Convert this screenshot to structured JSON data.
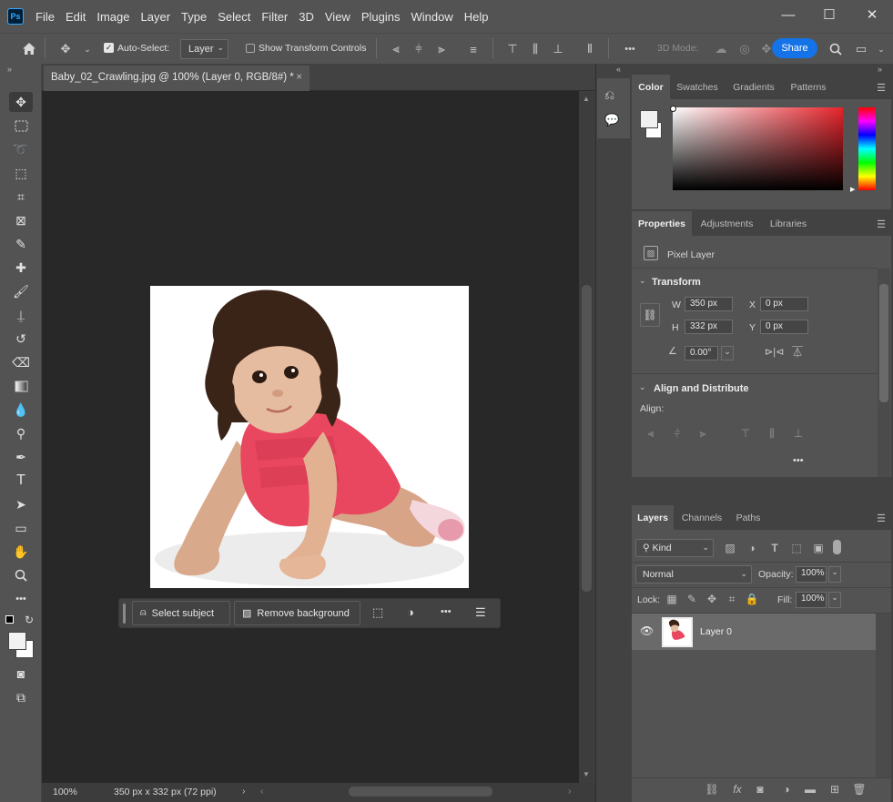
{
  "app": {
    "logo_text": "Ps"
  },
  "menu": [
    "File",
    "Edit",
    "Image",
    "Layer",
    "Type",
    "Select",
    "Filter",
    "3D",
    "View",
    "Plugins",
    "Window",
    "Help"
  ],
  "window_controls": {
    "minimize": "—",
    "maximize": "☐",
    "close": "✕"
  },
  "options": {
    "auto_select_label": "Auto-Select:",
    "auto_select_checked": true,
    "auto_select_target": "Layer",
    "show_transform_label": "Show Transform Controls",
    "mode_label": "3D Mode:",
    "share_label": "Share",
    "more": "•••"
  },
  "document": {
    "tab_title": "Baby_02_Crawling.jpg @ 100% (Layer 0, RGB/8#) *",
    "zoom": "100%",
    "info": "350 px x 332 px (72 ppi)"
  },
  "context_bar": {
    "select_subject": "Select subject",
    "remove_background": "Remove background",
    "more": "•••"
  },
  "color_panel": {
    "tabs": [
      "Color",
      "Swatches",
      "Gradients",
      "Patterns"
    ],
    "active_tab": "Color",
    "hue_color": "#e8242c"
  },
  "properties_panel": {
    "tabs": [
      "Properties",
      "Adjustments",
      "Libraries"
    ],
    "layer_type": "Pixel Layer",
    "transform_title": "Transform",
    "w_label": "W",
    "w_value": "350 px",
    "h_label": "H",
    "h_value": "332 px",
    "x_label": "X",
    "x_value": "0 px",
    "y_label": "Y",
    "y_value": "0 px",
    "angle_value": "0.00°",
    "align_title": "Align and Distribute",
    "align_label": "Align:",
    "more": "•••"
  },
  "layers_panel": {
    "tabs": [
      "Layers",
      "Channels",
      "Paths"
    ],
    "filter_kind": "Kind",
    "blend_mode": "Normal",
    "opacity_label": "Opacity:",
    "opacity_value": "100%",
    "lock_label": "Lock:",
    "fill_label": "Fill:",
    "fill_value": "100%",
    "layers": [
      {
        "name": "Layer 0",
        "visible": true
      }
    ]
  }
}
